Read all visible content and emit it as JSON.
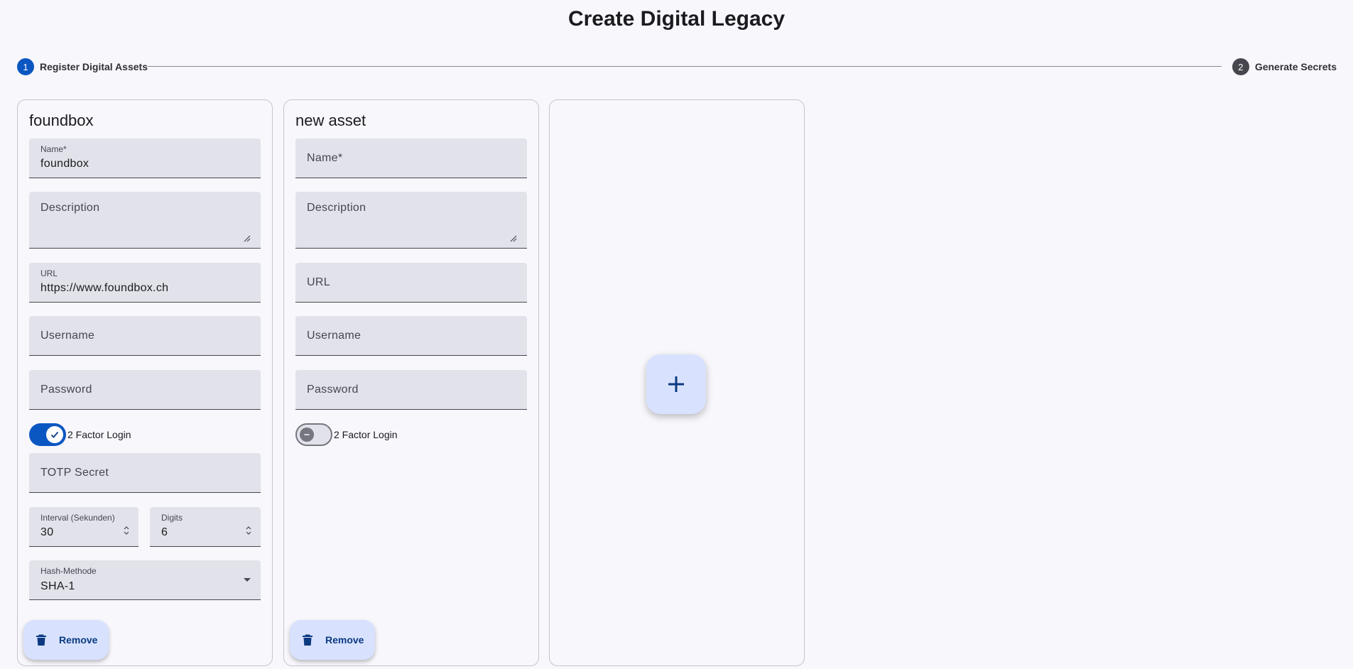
{
  "page": {
    "title": "Create Digital Legacy"
  },
  "stepper": {
    "steps": [
      {
        "number": "1",
        "label": "Register Digital Assets"
      },
      {
        "number": "2",
        "label": "Generate Secrets"
      }
    ]
  },
  "assets": [
    {
      "title": "foundbox",
      "name": {
        "label": "Name*",
        "value": "foundbox"
      },
      "description": {
        "label": "Description",
        "value": ""
      },
      "url": {
        "label": "URL",
        "value": "https://www.foundbox.ch"
      },
      "username": {
        "label": "Username",
        "value": ""
      },
      "password": {
        "label": "Password",
        "value": ""
      },
      "two_factor": {
        "label": "2 Factor Login",
        "enabled": true
      },
      "totp_secret": {
        "label": "TOTP Secret",
        "value": ""
      },
      "interval": {
        "label": "Interval (Sekunden)",
        "value": "30"
      },
      "digits": {
        "label": "Digits",
        "value": "6"
      },
      "hash_method": {
        "label": "Hash-Methode",
        "value": "SHA-1"
      },
      "remove_label": "Remove"
    },
    {
      "title": "new asset",
      "name": {
        "label": "Name*",
        "value": ""
      },
      "description": {
        "label": "Description",
        "value": ""
      },
      "url": {
        "label": "URL",
        "value": ""
      },
      "username": {
        "label": "Username",
        "value": ""
      },
      "password": {
        "label": "Password",
        "value": ""
      },
      "two_factor": {
        "label": "2 Factor Login",
        "enabled": false
      },
      "remove_label": "Remove"
    }
  ],
  "colors": {
    "primary": "#0b57c2",
    "container": "#d8e2ff",
    "field_bg": "#e1e2ea",
    "background": "#f8f7fc"
  }
}
